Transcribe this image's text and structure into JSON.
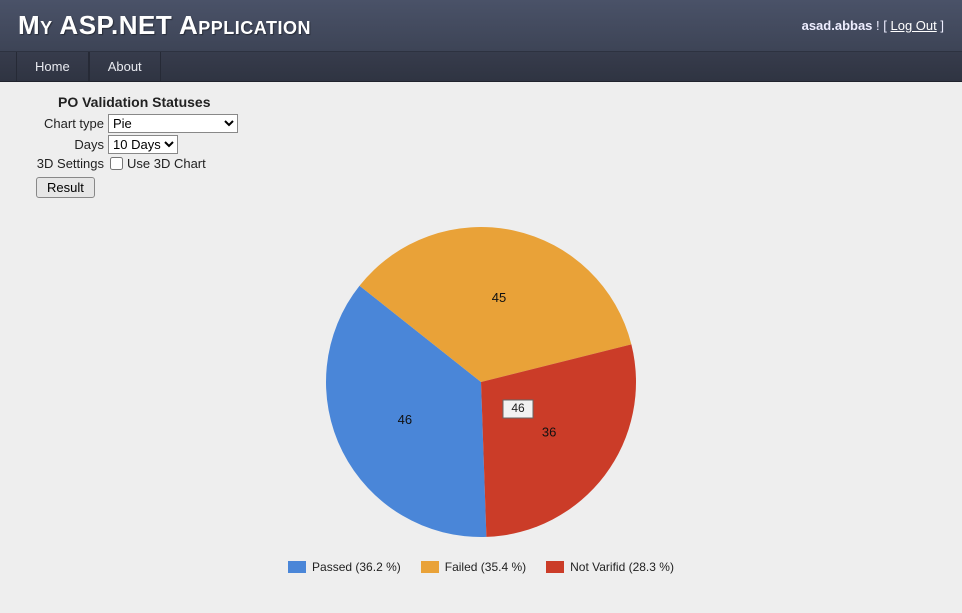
{
  "header": {
    "app_title": "My ASP.NET Application",
    "username": "asad.abbas",
    "logout_label": "Log Out"
  },
  "nav": {
    "home": "Home",
    "about": "About"
  },
  "form": {
    "section_title": "PO Validation Statuses",
    "chart_type_label": "Chart type",
    "chart_type_value": "Pie",
    "days_label": "Days",
    "days_value": "10 Days",
    "settings_label": "3D Settings",
    "checkbox_label": "Use 3D Chart",
    "result_button": "Result"
  },
  "legend": {
    "passed": "Passed (36.2 %)",
    "failed": "Failed (35.4 %)",
    "notverified": "Not Varifid (28.3 %)"
  },
  "tooltip_value": "46",
  "colors": {
    "passed": "#4a86d8",
    "failed": "#e9a238",
    "notverified": "#cb3c28"
  },
  "chart_data": {
    "type": "pie",
    "title": "PO Validation Statuses",
    "series": [
      {
        "name": "Passed",
        "value": 46,
        "percent": 36.2,
        "color": "#4a86d8"
      },
      {
        "name": "Failed",
        "value": 45,
        "percent": 35.4,
        "color": "#e9a238"
      },
      {
        "name": "Not Varifid",
        "value": 36,
        "percent": 28.3,
        "color": "#cb3c28"
      }
    ]
  }
}
